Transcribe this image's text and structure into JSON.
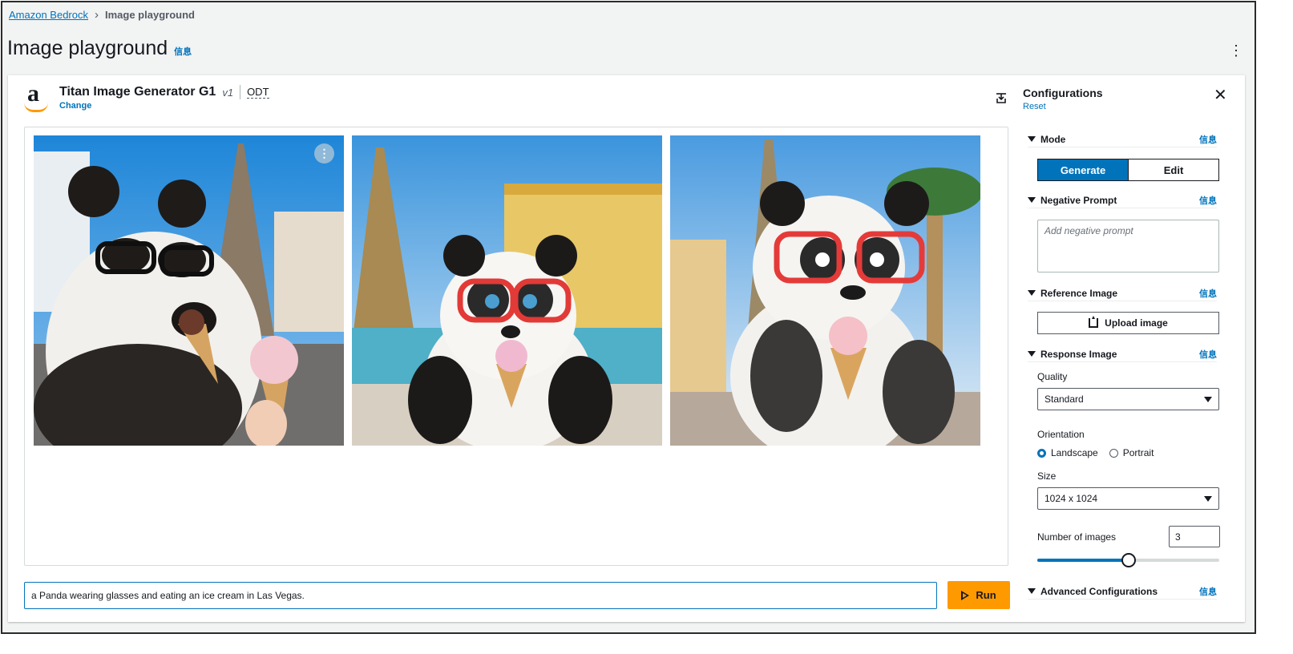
{
  "breadcrumb": {
    "root": "Amazon Bedrock",
    "current": "Image playground"
  },
  "page": {
    "title": "Image playground",
    "info": "信息"
  },
  "model": {
    "name": "Titan Image Generator G1",
    "version": "v1",
    "odt": "ODT",
    "change": "Change"
  },
  "images": [
    {
      "alt": "Panda wearing black glasses eating ice cream, photo style"
    },
    {
      "alt": "Cartoon panda with red glasses eating ice cream by fountain"
    },
    {
      "alt": "Cartoon panda with red glasses holding ice cream cone"
    }
  ],
  "prompt": {
    "value": "a Panda wearing glasses and eating an ice cream in Las Vegas."
  },
  "run": {
    "label": "Run"
  },
  "config": {
    "title": "Configurations",
    "reset": "Reset",
    "info": "信息",
    "mode": {
      "label": "Mode",
      "generate": "Generate",
      "edit": "Edit",
      "selected": "Generate"
    },
    "negative": {
      "label": "Negative Prompt",
      "placeholder": "Add negative prompt"
    },
    "reference": {
      "label": "Reference Image",
      "upload": "Upload image"
    },
    "response": {
      "label": "Response Image",
      "quality_label": "Quality",
      "quality_value": "Standard",
      "orientation_label": "Orientation",
      "orientation_options": [
        "Landscape",
        "Portrait"
      ],
      "orientation_selected": "Landscape",
      "size_label": "Size",
      "size_value": "1024 x 1024",
      "count_label": "Number of images",
      "count_value": "3",
      "count_slider_fraction": 0.5
    },
    "advanced": {
      "label": "Advanced Configurations"
    }
  },
  "colors": {
    "accent": "#0073bb",
    "run": "#ff9900",
    "link": "#0073bb"
  }
}
